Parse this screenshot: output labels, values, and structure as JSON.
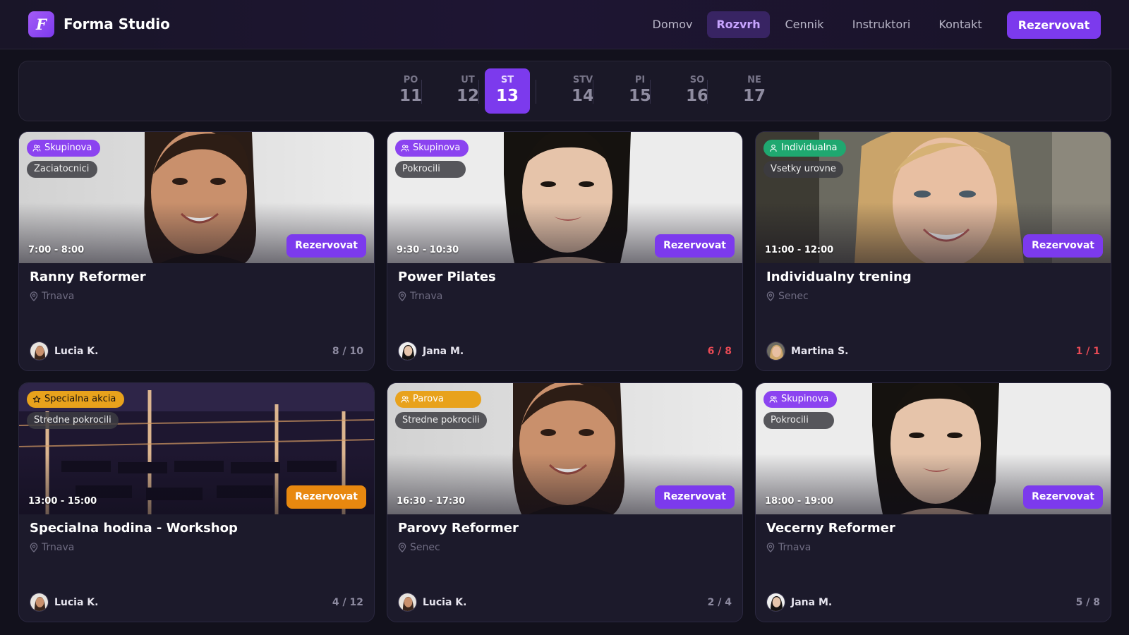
{
  "brand": {
    "logo_letter": "F",
    "name": "Forma Studio"
  },
  "nav": {
    "items": [
      "Domov",
      "Rozvrh",
      "Cennik",
      "Instruktori",
      "Kontakt"
    ],
    "active": "Rozvrh",
    "cta_label": "Rezervovat"
  },
  "days": [
    {
      "name": "PO",
      "num": "11",
      "active": false
    },
    {
      "name": "UT",
      "num": "12",
      "active": false
    },
    {
      "name": "ST",
      "num": "13",
      "active": true
    },
    {
      "name": "STV",
      "num": "14",
      "active": false
    },
    {
      "name": "PI",
      "num": "15",
      "active": false
    },
    {
      "name": "SO",
      "num": "16",
      "active": false
    },
    {
      "name": "NE",
      "num": "17",
      "active": false
    }
  ],
  "classes": [
    {
      "type": "Skupinova",
      "type_color": "purple",
      "level": "Zaciatocnici",
      "time": "7:00 - 8:00",
      "button": "Rezervovat",
      "title": "Ranny Reformer",
      "location": "Trnava",
      "instructor": "Lucia K.",
      "capacity": "8 / 10",
      "full": false,
      "image": "portrait-dark-hair"
    },
    {
      "type": "Skupinova",
      "type_color": "purple",
      "level": "Pokrocili",
      "time": "9:30 - 10:30",
      "button": "Rezervovat",
      "title": "Power Pilates",
      "location": "Trnava",
      "instructor": "Jana M.",
      "capacity": "6 / 8",
      "full": true,
      "image": "portrait-black-hair"
    },
    {
      "type": "Individualna",
      "type_color": "green",
      "level": "Vsetky urovne",
      "time": "11:00 - 12:00",
      "button": "Rezervovat",
      "title": "Individualny trening",
      "location": "Senec",
      "instructor": "Martina S.",
      "capacity": "1 / 1",
      "full": true,
      "image": "portrait-blonde-hair"
    },
    {
      "type": "Specialna akcia",
      "type_color": "amber",
      "level": "Stredne pokrocili",
      "time": "13:00 - 15:00",
      "button": "Rezervovat",
      "title": "Specialna hodina - Workshop",
      "location": "Trnava",
      "instructor": "Lucia K.",
      "capacity": "4 / 12",
      "full": false,
      "image": "studio-interior"
    },
    {
      "type": "Parova",
      "type_color": "amber",
      "level": "Stredne pokrocili",
      "time": "16:30 - 17:30",
      "button": "Rezervovat",
      "title": "Parovy Reformer",
      "location": "Senec",
      "instructor": "Lucia K.",
      "capacity": "2 / 4",
      "full": false,
      "image": "portrait-dark-hair"
    },
    {
      "type": "Skupinova",
      "type_color": "purple",
      "level": "Pokrocili",
      "time": "18:00 - 19:00",
      "button": "Rezervovat",
      "title": "Vecerny Reformer",
      "location": "Trnava",
      "instructor": "Jana M.",
      "capacity": "5 / 8",
      "full": false,
      "image": "portrait-black-hair"
    }
  ],
  "colors": {
    "accent": "#7c3aed",
    "special": "#e8880f",
    "full_capacity": "#e84a55",
    "background": "#12111c",
    "card": "#1c1a2b"
  }
}
